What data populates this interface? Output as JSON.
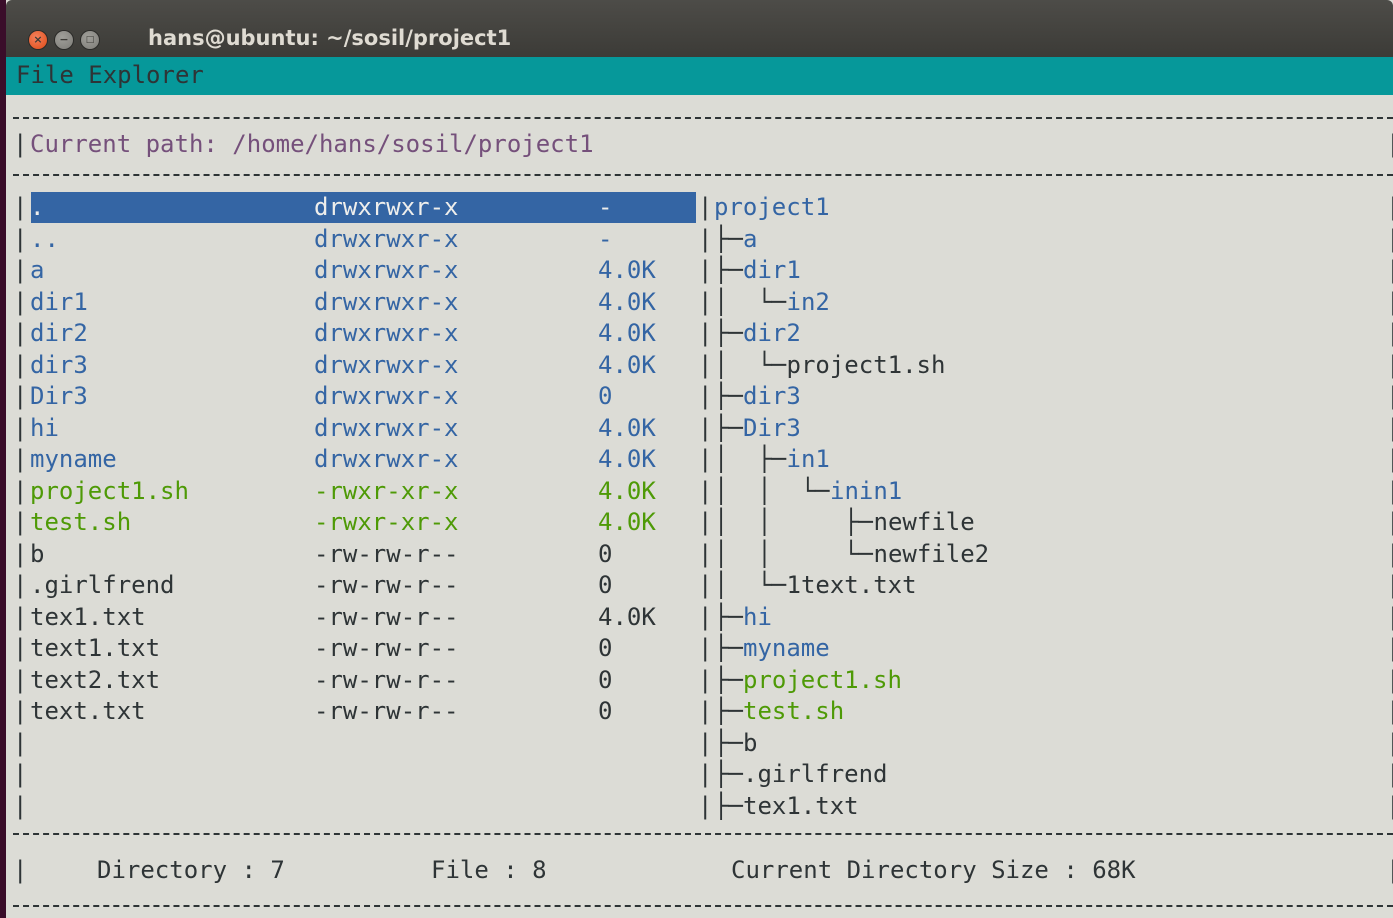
{
  "window": {
    "title": "hans@ubuntu: ~/sosil/project1",
    "close_glyph": "×",
    "minimize_glyph": "−",
    "maximize_glyph": "□"
  },
  "menubar": {
    "title": "File Explorer"
  },
  "header": {
    "path_label": "Current path: /home/hans/sosil/project1"
  },
  "files": [
    {
      "name": ".",
      "perm": "drwxrwxr-x",
      "size": "-",
      "type": "dir",
      "selected": true
    },
    {
      "name": "..",
      "perm": "drwxrwxr-x",
      "size": "-",
      "type": "dir"
    },
    {
      "name": "a",
      "perm": "drwxrwxr-x",
      "size": "4.0K",
      "type": "dir"
    },
    {
      "name": "dir1",
      "perm": "drwxrwxr-x",
      "size": "4.0K",
      "type": "dir"
    },
    {
      "name": "dir2",
      "perm": "drwxrwxr-x",
      "size": "4.0K",
      "type": "dir"
    },
    {
      "name": "dir3",
      "perm": "drwxrwxr-x",
      "size": "4.0K",
      "type": "dir"
    },
    {
      "name": "Dir3",
      "perm": "drwxrwxr-x",
      "size": "0",
      "type": "dir"
    },
    {
      "name": "hi",
      "perm": "drwxrwxr-x",
      "size": "4.0K",
      "type": "dir"
    },
    {
      "name": "myname",
      "perm": "drwxrwxr-x",
      "size": "4.0K",
      "type": "dir"
    },
    {
      "name": "project1.sh",
      "perm": "-rwxr-xr-x",
      "size": "4.0K",
      "type": "exec"
    },
    {
      "name": "test.sh",
      "perm": "-rwxr-xr-x",
      "size": "4.0K",
      "type": "exec"
    },
    {
      "name": "b",
      "perm": "-rw-rw-r--",
      "size": "0",
      "type": "file"
    },
    {
      "name": ".girlfrend",
      "perm": "-rw-rw-r--",
      "size": "0",
      "type": "file"
    },
    {
      "name": "tex1.txt",
      "perm": "-rw-rw-r--",
      "size": "4.0K",
      "type": "file"
    },
    {
      "name": "text1.txt",
      "perm": "-rw-rw-r--",
      "size": "0",
      "type": "file"
    },
    {
      "name": "text2.txt",
      "perm": "-rw-rw-r--",
      "size": "0",
      "type": "file"
    },
    {
      "name": "text.txt",
      "perm": "-rw-rw-r--",
      "size": "0",
      "type": "file"
    }
  ],
  "tree": [
    {
      "prefix": "",
      "name": "project1",
      "type": "dir"
    },
    {
      "prefix": "├─",
      "name": "a",
      "type": "dir"
    },
    {
      "prefix": "├─",
      "name": "dir1",
      "type": "dir"
    },
    {
      "prefix": "│  └─",
      "name": "in2",
      "type": "dir"
    },
    {
      "prefix": "├─",
      "name": "dir2",
      "type": "dir"
    },
    {
      "prefix": "│  └─",
      "name": "project1.sh",
      "type": "file"
    },
    {
      "prefix": "├─",
      "name": "dir3",
      "type": "dir"
    },
    {
      "prefix": "├─",
      "name": "Dir3",
      "type": "dir"
    },
    {
      "prefix": "│  ├─",
      "name": "in1",
      "type": "dir"
    },
    {
      "prefix": "│  │  └─",
      "name": "inin1",
      "type": "dir"
    },
    {
      "prefix": "│  │     ├─",
      "name": "newfile",
      "type": "file"
    },
    {
      "prefix": "│  │     └─",
      "name": "newfile2",
      "type": "file"
    },
    {
      "prefix": "│  └─",
      "name": "1text.txt",
      "type": "file"
    },
    {
      "prefix": "├─",
      "name": "hi",
      "type": "dir"
    },
    {
      "prefix": "├─",
      "name": "myname",
      "type": "dir"
    },
    {
      "prefix": "├─",
      "name": "project1.sh",
      "type": "exec"
    },
    {
      "prefix": "├─",
      "name": "test.sh",
      "type": "exec"
    },
    {
      "prefix": "├─",
      "name": "b",
      "type": "file"
    },
    {
      "prefix": "├─",
      "name": ".girlfrend",
      "type": "file"
    },
    {
      "prefix": "├─",
      "name": "tex1.txt",
      "type": "file"
    }
  ],
  "status": {
    "directory": "Directory : 7",
    "file": "File : 8",
    "size": "Current Directory Size : 68K"
  },
  "colors": {
    "terminal_bg": "#dcdcd6",
    "menubar": "#06989a",
    "selection": "#3465a4",
    "directory": "#3465a4",
    "executable": "#4e9a06",
    "regular": "#2e3436",
    "path": "#75507b"
  }
}
